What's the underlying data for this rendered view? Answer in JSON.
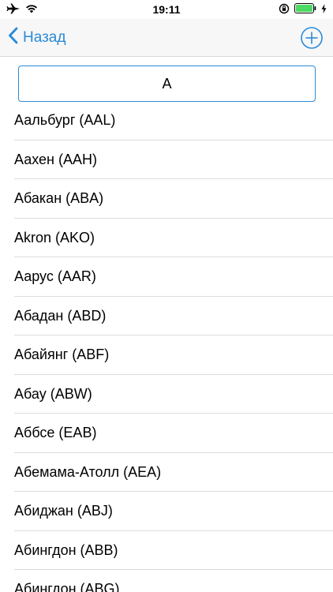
{
  "status_bar": {
    "time": "19:11",
    "icons": [
      "airplane-icon",
      "wifi-icon",
      "orientation-lock-icon",
      "battery-icon",
      "charging-icon"
    ]
  },
  "navbar": {
    "back_label": "Назад",
    "back_icon": "chevron-left-icon",
    "add_icon": "plus-circle-icon",
    "accent": "#2a8ad8"
  },
  "search": {
    "value": "А"
  },
  "airports": [
    "Аальбург (AAL)",
    "Аахен (AAH)",
    "Абакан (ABA)",
    "Akron (AKO)",
    "Аарус (AAR)",
    "Абадан (ABD)",
    "Абайянг (ABF)",
    "Абау (ABW)",
    "Аббсе (EAB)",
    "Абемама-Атолл (AEA)",
    "Абиджан (ABJ)",
    "Абингдон (ABB)",
    "Абингдон (ABG)"
  ]
}
